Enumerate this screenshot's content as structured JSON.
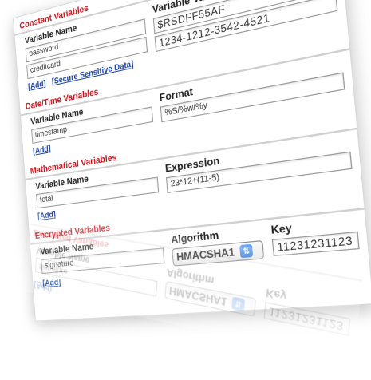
{
  "sections": {
    "constant": {
      "title": "Constant Variables",
      "col1": "Variable Name",
      "col2": "Variable Value",
      "rows": [
        {
          "name": "password",
          "value": "$RSDFF55AF"
        },
        {
          "name": "creditcard",
          "value": "1234-1212-3542-4521"
        }
      ],
      "links": [
        "[Add]",
        "[Secure Sensitive Data]"
      ]
    },
    "datetime": {
      "title": "Date/Time Variables",
      "col1": "Variable Name",
      "col2": "Format",
      "rows": [
        {
          "name": "timestamp",
          "value": "%S/%w/%y"
        }
      ],
      "links": [
        "[Add]"
      ]
    },
    "math": {
      "title": "Mathematical Variables",
      "col1": "Variable Name",
      "col2": "Expression",
      "rows": [
        {
          "name": "total",
          "value": "23*12+(11-5)"
        }
      ],
      "links": [
        "[Add]"
      ]
    },
    "encrypted": {
      "title": "Encrypted Variables",
      "col1": "Variable Name",
      "col2": "Algorithm",
      "col3": "Key",
      "rows": [
        {
          "name": "signature",
          "algorithm": "HMACSHA1",
          "key": "11231231123"
        }
      ],
      "links": [
        "[Add]"
      ]
    }
  }
}
